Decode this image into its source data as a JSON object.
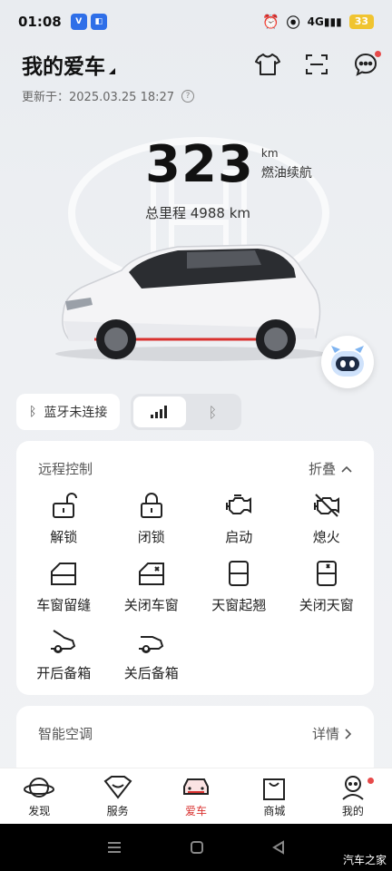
{
  "status": {
    "time": "01:08",
    "battery": "33",
    "network": "4G"
  },
  "header": {
    "title": "我的爱车"
  },
  "updated": "更新于：2025.03.25 18:27",
  "range": {
    "value": "323",
    "unit": "km",
    "label": "燃油续航"
  },
  "odometer": "总里程 4988 km",
  "bluetooth": {
    "status_label": "蓝牙未连接"
  },
  "remote": {
    "title": "远程控制",
    "collapse_label": "折叠",
    "items": [
      {
        "label": "解锁",
        "icon": "unlock-icon"
      },
      {
        "label": "闭锁",
        "icon": "lock-icon"
      },
      {
        "label": "启动",
        "icon": "engine-start-icon"
      },
      {
        "label": "熄火",
        "icon": "engine-off-icon"
      },
      {
        "label": "车窗留缝",
        "icon": "window-vent-icon"
      },
      {
        "label": "关闭车窗",
        "icon": "window-close-icon"
      },
      {
        "label": "天窗起翘",
        "icon": "sunroof-tilt-icon"
      },
      {
        "label": "关闭天窗",
        "icon": "sunroof-close-icon"
      },
      {
        "label": "开后备箱",
        "icon": "trunk-open-icon"
      },
      {
        "label": "关后备箱",
        "icon": "trunk-close-icon"
      }
    ]
  },
  "ac": {
    "title": "智能空调",
    "detail_label": "详情"
  },
  "tabs": [
    {
      "label": "发现",
      "icon": "planet-icon"
    },
    {
      "label": "服务",
      "icon": "service-icon"
    },
    {
      "label": "爱车",
      "icon": "car-icon",
      "active": true
    },
    {
      "label": "商城",
      "icon": "shop-bag-icon"
    },
    {
      "label": "我的",
      "icon": "profile-icon"
    }
  ],
  "watermark": "汽车之家",
  "colors": {
    "accent": "#d9312f",
    "badge": "#e74a4a",
    "battery": "#f0c430"
  }
}
